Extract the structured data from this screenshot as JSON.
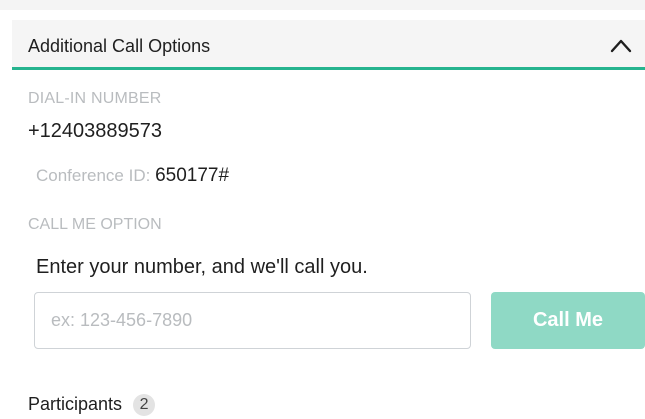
{
  "header": {
    "title": "Additional Call Options",
    "toggle_icon": "chevron-up-icon"
  },
  "dial_in": {
    "label": "DIAL-IN NUMBER",
    "number": "+12403889573",
    "conference_label": "Conference ID:",
    "conference_id": "650177#"
  },
  "call_me": {
    "label": "CALL ME OPTION",
    "prompt": "Enter your number, and we'll call you.",
    "input_placeholder": "ex: 123-456-7890",
    "input_value": "",
    "button_label": "Call Me"
  },
  "participants": {
    "label": "Participants",
    "count": "2"
  },
  "colors": {
    "accent": "#26b48f",
    "button_bg": "#8fd9c5",
    "muted_text": "#b9bcbf"
  }
}
